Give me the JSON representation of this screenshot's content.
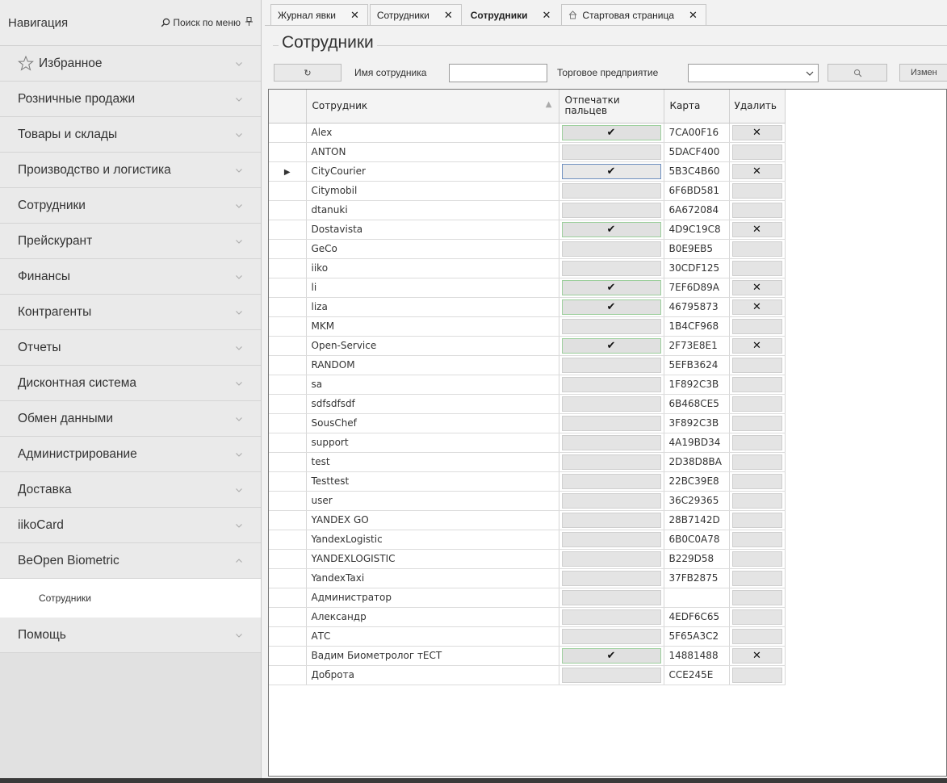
{
  "nav": {
    "title": "Навигация",
    "search_label": "Поиск по меню",
    "items": [
      {
        "label": "Избранное",
        "icon": "star-icon"
      },
      {
        "label": "Розничные продажи"
      },
      {
        "label": "Товары и склады"
      },
      {
        "label": "Производство и логистика"
      },
      {
        "label": "Сотрудники"
      },
      {
        "label": "Прейскурант"
      },
      {
        "label": "Финансы"
      },
      {
        "label": "Контрагенты"
      },
      {
        "label": "Отчеты"
      },
      {
        "label": "Дисконтная система"
      },
      {
        "label": "Обмен данными"
      },
      {
        "label": "Администрирование"
      },
      {
        "label": "Доставка"
      },
      {
        "label": "iikoCard"
      },
      {
        "label": "BeOpen Biometric",
        "expanded": true
      }
    ],
    "sub_item": "Сотрудники",
    "help": "Помощь"
  },
  "tabs": [
    {
      "label": "Журнал явки",
      "active": false
    },
    {
      "label": "Сотрудники",
      "active": false
    },
    {
      "label": "Сотрудники",
      "active": true
    },
    {
      "label": "Стартовая страница",
      "active": false,
      "icon": "home-icon"
    }
  ],
  "page_title": "Сотрудники",
  "toolbar": {
    "refresh_icon": "↻",
    "name_label": "Имя сотрудника",
    "name_value": "",
    "company_label": "Торговое предприятие",
    "company_value": "",
    "search_icon": "search-icon",
    "edit_label": "Измен"
  },
  "grid": {
    "columns": [
      "Сотрудник",
      "Отпечатки пальцев",
      "Карта",
      "Удалить"
    ],
    "rows": [
      {
        "name": "Alex",
        "fp": true,
        "card": "7CA00F16",
        "del": true
      },
      {
        "name": "ANTON",
        "fp": false,
        "card": "5DACF400",
        "del": false
      },
      {
        "name": "CityCourier",
        "fp": true,
        "card": "5B3C4B60",
        "del": true,
        "current": true
      },
      {
        "name": "Citymobil",
        "fp": false,
        "card": "6F6BD581",
        "del": false
      },
      {
        "name": "dtanuki",
        "fp": false,
        "card": "6A672084",
        "del": false
      },
      {
        "name": "Dostavista",
        "fp": true,
        "card": "4D9C19C8",
        "del": true
      },
      {
        "name": "GeCo",
        "fp": false,
        "card": "B0E9EB5",
        "del": false
      },
      {
        "name": "iiko",
        "fp": false,
        "card": "30CDF125",
        "del": false
      },
      {
        "name": "li",
        "fp": true,
        "card": "7EF6D89A",
        "del": true
      },
      {
        "name": "liza",
        "fp": true,
        "card": "46795873",
        "del": true
      },
      {
        "name": "MKM",
        "fp": false,
        "card": "1B4CF968",
        "del": false
      },
      {
        "name": "Open-Service",
        "fp": true,
        "card": "2F73E8E1",
        "del": true
      },
      {
        "name": "RANDOM",
        "fp": false,
        "card": "5EFB3624",
        "del": false
      },
      {
        "name": "sa",
        "fp": false,
        "card": "1F892C3B",
        "del": false
      },
      {
        "name": "sdfsdfsdf",
        "fp": false,
        "card": "6B468CE5",
        "del": false
      },
      {
        "name": "SousChef",
        "fp": false,
        "card": "3F892C3B",
        "del": false
      },
      {
        "name": "support",
        "fp": false,
        "card": "4A19BD34",
        "del": false
      },
      {
        "name": "test",
        "fp": false,
        "card": "2D38D8BA",
        "del": false
      },
      {
        "name": "Testtest",
        "fp": false,
        "card": "22BC39E8",
        "del": false
      },
      {
        "name": "user",
        "fp": false,
        "card": "36C29365",
        "del": false
      },
      {
        "name": "YANDEX GO",
        "fp": false,
        "card": "28B7142D",
        "del": false
      },
      {
        "name": "YandexLogistic",
        "fp": false,
        "card": "6B0C0A78",
        "del": false
      },
      {
        "name": "YANDEXLOGISTIC",
        "fp": false,
        "card": "B229D58",
        "del": false
      },
      {
        "name": "YandexTaxi",
        "fp": false,
        "card": "37FB2875",
        "del": false
      },
      {
        "name": "Администратор",
        "fp": false,
        "card": "",
        "del": false
      },
      {
        "name": "Александр",
        "fp": false,
        "card": "4EDF6C65",
        "del": false
      },
      {
        "name": "АТС",
        "fp": false,
        "card": "5F65A3C2",
        "del": false
      },
      {
        "name": "Вадим Биометролог тЕСТ",
        "fp": true,
        "card": "14881488",
        "del": true
      },
      {
        "name": "Доброта",
        "fp": false,
        "card": "CCE245E",
        "del": false
      }
    ]
  },
  "symbols": {
    "check": "✔",
    "cross": "✕",
    "close": "✕"
  }
}
